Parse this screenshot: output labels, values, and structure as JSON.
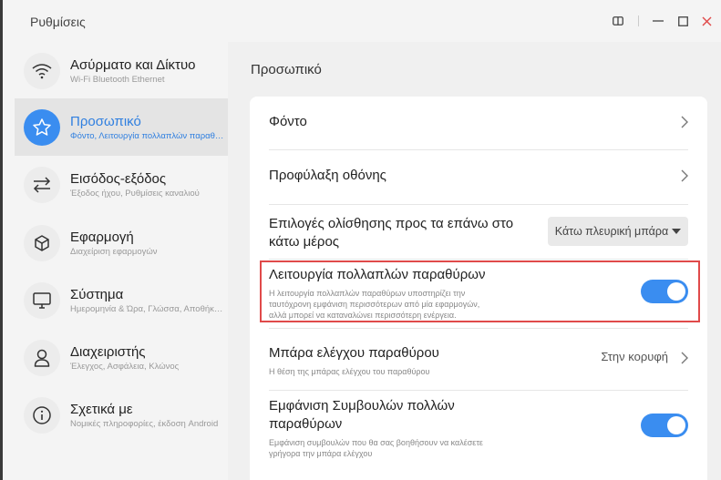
{
  "window": {
    "title": "Ρυθμίσεις"
  },
  "sidebar": {
    "items": [
      {
        "label": "Ασύρματο και Δίκτυο",
        "sub": "Wi-Fi Bluetooth Ethernet",
        "icon": "wifi-icon"
      },
      {
        "label": "Προσωπικό",
        "sub": "Φόντο, Λειτουργία πολλαπλών παραθύρων",
        "icon": "star-icon"
      },
      {
        "label": "Εισόδος-εξόδος",
        "sub": "Έξοδος ήχου, Ρυθμίσεις καναλιού",
        "icon": "swap-arrows-icon"
      },
      {
        "label": "Εφαρμογή",
        "sub": "Διαχείριση εφαρμογών",
        "icon": "cube-icon"
      },
      {
        "label": "Σύστημα",
        "sub": "Ημερομηνία & Ώρα, Γλώσσα, Αποθήκευση",
        "icon": "monitor-icon"
      },
      {
        "label": "Διαχειριστής",
        "sub": "Έλεγχος, Ασφάλεια, Κλώνος",
        "icon": "user-icon"
      },
      {
        "label": "Σχετικά με",
        "sub": "Νομικές πληροφορίες, έκδοση Android",
        "icon": "info-icon"
      }
    ]
  },
  "main": {
    "title": "Προσωπικό",
    "rows": {
      "wallpaper": {
        "label": "Φόντο"
      },
      "screensaver": {
        "label": "Προφύλαξη οθόνης"
      },
      "swipe": {
        "label1": "Επιλογές ολίσθησης προς τα επάνω στο",
        "label2": "κάτω μέρος",
        "value": "Κάτω πλευρική μπάρα"
      },
      "multiwindow": {
        "label": "Λειτουργία πολλαπλών παραθύρων",
        "desc1": "Η λειτουργία πολλαπλών παραθύρων υποστηρίζει την",
        "desc2": "ταυτόχρονη εμφάνιση περισσότερων από μία εφαρμογών,",
        "desc3": "αλλά μπορεί να καταναλώνει περισσότερη ενέργεια.",
        "enabled": true
      },
      "controlbar": {
        "label": "Μπάρα ελέγχου παραθύρου",
        "desc": "Η θέση της μπάρας ελέγχου του παραθύρου",
        "value": "Στην κορυφή"
      },
      "tips": {
        "label1": "Εμφάνιση Συμβουλών πολλών",
        "label2": "παραθύρων",
        "desc1": "Εμφάνιση συμβουλών που θα σας βοηθήσουν να καλέσετε",
        "desc2": "γρήγορα την μπάρα ελέγχου",
        "enabled": true
      }
    }
  },
  "colors": {
    "accent": "#3a8df0",
    "highlight_border": "#e04a4a"
  }
}
